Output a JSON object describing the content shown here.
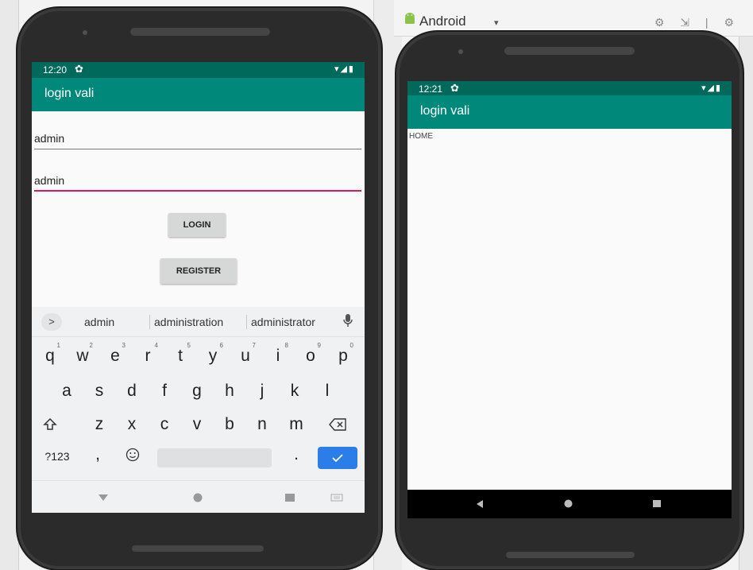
{
  "ide": {
    "run_target": "Android",
    "dropdown_glyph": "▾",
    "toolbar_glyphs": "⚙ ⇲ | ⚙"
  },
  "left_device": {
    "status": {
      "time": "12:20",
      "settings_glyph": "✿",
      "system_glyphs": "▾◢▮"
    },
    "app_title": "login vali",
    "username_value": "admin",
    "password_value": "admin",
    "login_label": "LOGIN",
    "register_label": "REGISTER",
    "keyboard": {
      "suggest_chevron": ">",
      "suggestions": [
        "admin",
        "administration",
        "administrator"
      ],
      "row1": [
        {
          "k": "q",
          "n": "1"
        },
        {
          "k": "w",
          "n": "2"
        },
        {
          "k": "e",
          "n": "3"
        },
        {
          "k": "r",
          "n": "4"
        },
        {
          "k": "t",
          "n": "5"
        },
        {
          "k": "y",
          "n": "6"
        },
        {
          "k": "u",
          "n": "7"
        },
        {
          "k": "i",
          "n": "8"
        },
        {
          "k": "o",
          "n": "9"
        },
        {
          "k": "p",
          "n": "0"
        }
      ],
      "row2": [
        "a",
        "s",
        "d",
        "f",
        "g",
        "h",
        "j",
        "k",
        "l"
      ],
      "row3": [
        "z",
        "x",
        "c",
        "v",
        "b",
        "n",
        "m"
      ],
      "symbols_label": "?123",
      "comma": ",",
      "period": ".",
      "icons": {
        "shift": "shift-icon",
        "backspace": "backspace-icon",
        "emoji": "emoji-icon",
        "mic": "mic-icon",
        "enter": "check-icon"
      }
    }
  },
  "right_device": {
    "status": {
      "time": "12:21",
      "settings_glyph": "✿",
      "system_glyphs": "▾◢▮"
    },
    "app_title": "login vali",
    "home_text": "HOME"
  },
  "colors": {
    "status_bar": "#00695c",
    "app_bar": "#00897b",
    "accent": "#d81b60",
    "enter_key": "#2b7de9"
  }
}
